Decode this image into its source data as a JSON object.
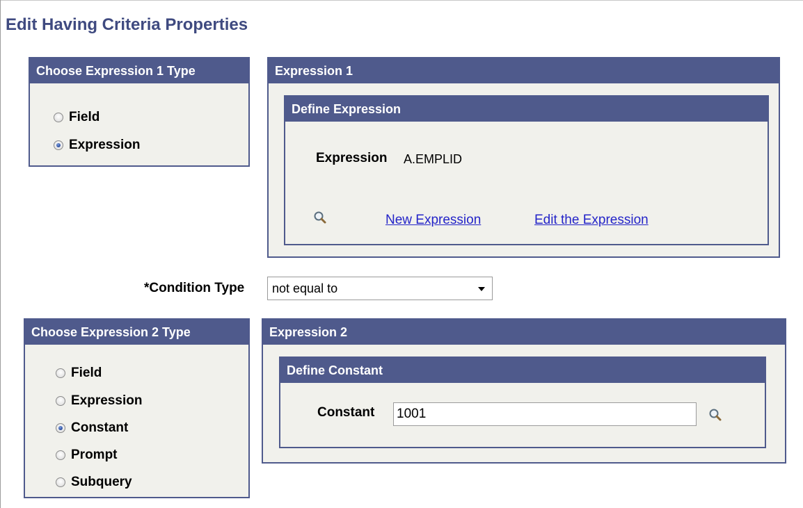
{
  "page": {
    "title": "Edit Having Criteria Properties"
  },
  "expression1_type": {
    "header": "Choose Expression 1 Type",
    "options": [
      {
        "label": "Field",
        "checked": false
      },
      {
        "label": "Expression",
        "checked": true
      }
    ]
  },
  "expression1": {
    "header": "Expression 1",
    "define_header": "Define Expression",
    "expression_label": "Expression",
    "expression_value": "A.EMPLID",
    "lookup_icon": "magnifier-icon",
    "new_expression_link": "New Expression",
    "edit_expression_link": "Edit the Expression"
  },
  "condition": {
    "label": "*Condition Type",
    "selected": "not equal to"
  },
  "expression2_type": {
    "header": "Choose Expression 2 Type",
    "options": [
      {
        "label": "Field",
        "checked": false
      },
      {
        "label": "Expression",
        "checked": false
      },
      {
        "label": "Constant",
        "checked": true
      },
      {
        "label": "Prompt",
        "checked": false
      },
      {
        "label": "Subquery",
        "checked": false
      }
    ]
  },
  "expression2": {
    "header": "Expression 2",
    "define_header": "Define Constant",
    "constant_label": "Constant",
    "constant_value": "1001",
    "lookup_icon": "magnifier-icon"
  },
  "colors": {
    "header_bg": "#4f5a8c",
    "title": "#3f4a80",
    "panel_bg": "#f1f1ec",
    "link": "#2424c8"
  }
}
